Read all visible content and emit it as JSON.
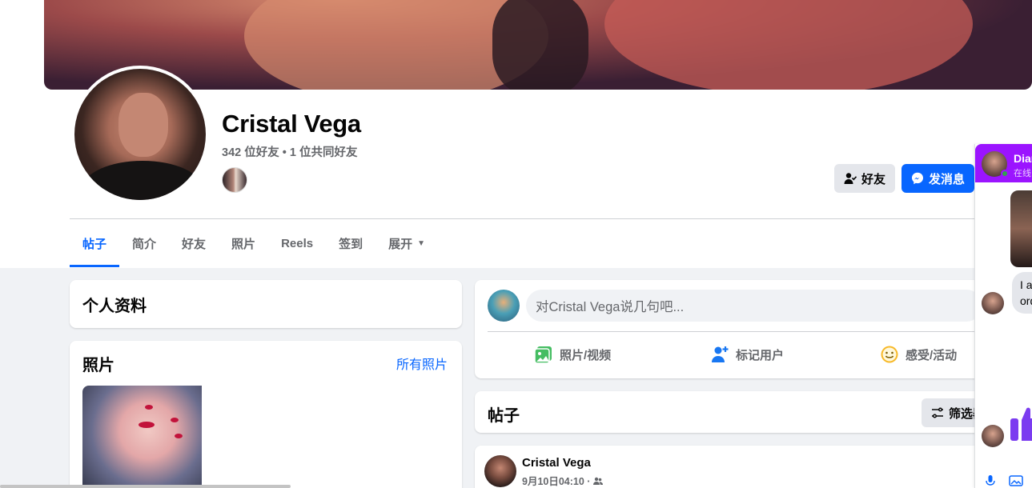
{
  "profile": {
    "name": "Cristal Vega",
    "friend_count": "342 位好友 • 1 位共同好友"
  },
  "actions": {
    "friend_label": "好友",
    "message_label": "发消息"
  },
  "tabs": [
    {
      "label": "帖子"
    },
    {
      "label": "简介"
    },
    {
      "label": "好友"
    },
    {
      "label": "照片"
    },
    {
      "label": "Reels"
    },
    {
      "label": "签到"
    },
    {
      "label": "展开"
    }
  ],
  "intro": {
    "title": "个人资料"
  },
  "photos": {
    "title": "照片",
    "all_link": "所有照片"
  },
  "composer": {
    "placeholder": "对Cristal Vega说几句吧...",
    "photo_video": "照片/视频",
    "tag_people": "标记用户",
    "feeling": "感受/活动"
  },
  "posts_section": {
    "title": "帖子",
    "filter_label": "筛选器"
  },
  "post": {
    "author": "Cristal Vega",
    "time": "9月10日04:10 ·"
  },
  "chat": {
    "name": "Diana",
    "status": "在线",
    "message": "I a\nord"
  },
  "colors": {
    "accent": "#0866ff",
    "chat_header": "#9b14ff",
    "online": "#31a24c"
  }
}
